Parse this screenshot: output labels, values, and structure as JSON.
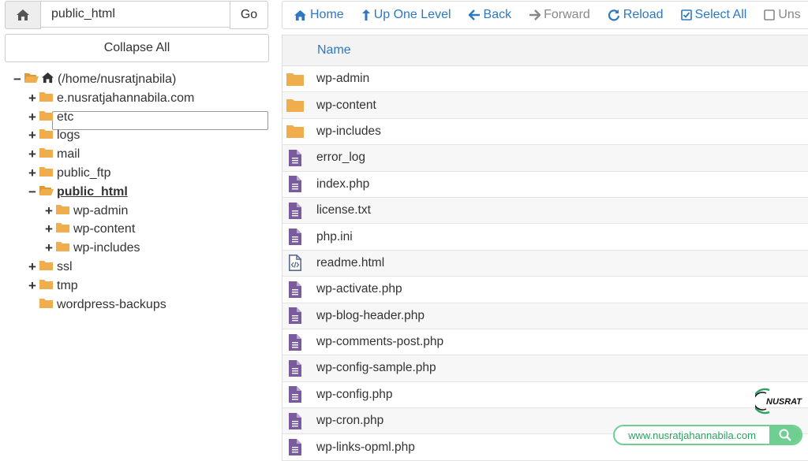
{
  "pathbar": {
    "path_value": "public_html",
    "go_label": "Go",
    "home_icon": "home-icon"
  },
  "collapse_label": "Collapse All",
  "tree": [
    {
      "label": "(/home/nusratjnabila)",
      "toggle": "−",
      "indent": 0,
      "home": true,
      "open": true
    },
    {
      "label": "e.nusratjahannabila.com",
      "toggle": "+",
      "indent": 1
    },
    {
      "label": "etc",
      "toggle": "+",
      "indent": 1
    },
    {
      "label": "logs",
      "toggle": "+",
      "indent": 1
    },
    {
      "label": "mail",
      "toggle": "+",
      "indent": 1
    },
    {
      "label": "public_ftp",
      "toggle": "+",
      "indent": 1
    },
    {
      "label": "public_html",
      "toggle": "−",
      "indent": 1,
      "open": true,
      "selected": true
    },
    {
      "label": "wp-admin",
      "toggle": "+",
      "indent": 2
    },
    {
      "label": "wp-content",
      "toggle": "+",
      "indent": 2
    },
    {
      "label": "wp-includes",
      "toggle": "+",
      "indent": 2
    },
    {
      "label": "ssl",
      "toggle": "+",
      "indent": 1
    },
    {
      "label": "tmp",
      "toggle": "+",
      "indent": 1
    },
    {
      "label": "wordpress-backups",
      "toggle": "",
      "indent": 1
    }
  ],
  "toolbar": {
    "home": "Home",
    "up": "Up One Level",
    "back": "Back",
    "forward": "Forward",
    "reload": "Reload",
    "select_all": "Select All",
    "unselect": "Uns"
  },
  "table": {
    "name_header": "Name",
    "rows": [
      {
        "name": "wp-admin",
        "type": "folder"
      },
      {
        "name": "wp-content",
        "type": "folder"
      },
      {
        "name": "wp-includes",
        "type": "folder"
      },
      {
        "name": "error_log",
        "type": "file"
      },
      {
        "name": "index.php",
        "type": "file"
      },
      {
        "name": "license.txt",
        "type": "file"
      },
      {
        "name": "php.ini",
        "type": "file"
      },
      {
        "name": "readme.html",
        "type": "html"
      },
      {
        "name": "wp-activate.php",
        "type": "file"
      },
      {
        "name": "wp-blog-header.php",
        "type": "file"
      },
      {
        "name": "wp-comments-post.php",
        "type": "file"
      },
      {
        "name": "wp-config-sample.php",
        "type": "file"
      },
      {
        "name": "wp-config.php",
        "type": "file"
      },
      {
        "name": "wp-cron.php",
        "type": "file"
      },
      {
        "name": "wp-links-opml.php",
        "type": "file"
      }
    ]
  },
  "watermark": {
    "brand": "NUSRAT",
    "url": "www.nusratjahannabila.com"
  },
  "colors": {
    "link": "#2d78c2",
    "folder": "#f0ad4e",
    "file": "#7a5c9e",
    "accent_green": "#6fcf93"
  }
}
